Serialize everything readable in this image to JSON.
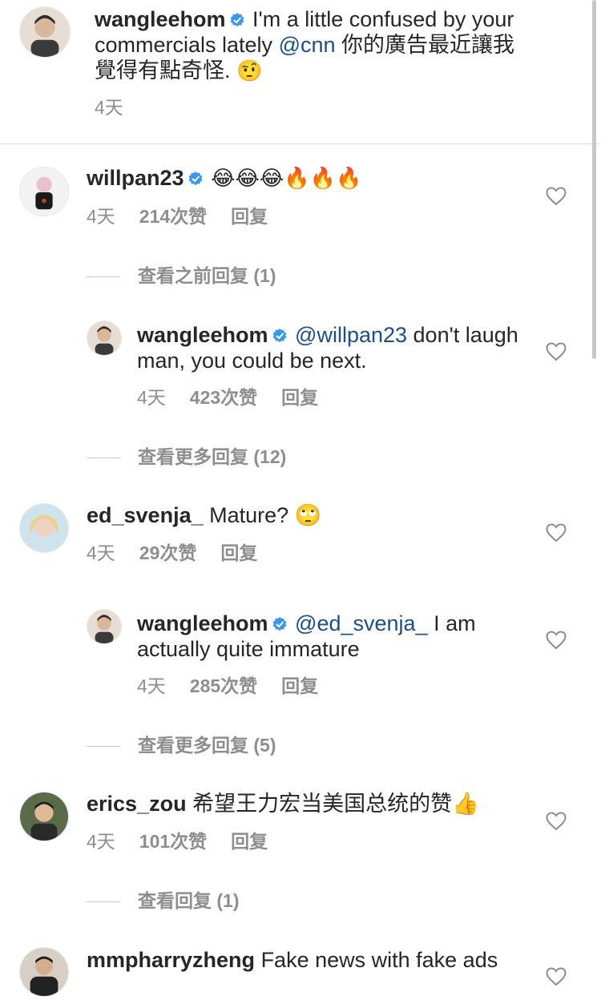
{
  "caption": {
    "username": "wangleehom",
    "text_before": "I'm a little confused by your commercials lately ",
    "mention": "@cnn",
    "text_after": " 你的廣告最近讓我覺得有點奇怪.",
    "emoji": "🤨",
    "time": "4天"
  },
  "comments": [
    {
      "username": "willpan23",
      "text": "😂😂😂🔥🔥🔥",
      "time": "4天",
      "likes": "214次赞",
      "reply": "回复",
      "view_more": "查看之前回复 (1)",
      "replies": [
        {
          "username": "wangleehom",
          "mention": "@willpan23",
          "text": " don't laugh man, you could be next.",
          "time": "4天",
          "likes": "423次赞",
          "reply": "回复"
        }
      ],
      "view_more_after": "查看更多回复 (12)"
    },
    {
      "username": "ed_svenja_",
      "text": "Mature? 🙄",
      "time": "4天",
      "likes": "29次赞",
      "reply": "回复",
      "replies": [
        {
          "username": "wangleehom",
          "mention": "@ed_svenja_",
          "text": " I am actually quite immature",
          "time": "4天",
          "likes": "285次赞",
          "reply": "回复"
        }
      ],
      "view_more_after": "查看更多回复 (5)"
    },
    {
      "username": "erics_zou",
      "text": "希望王力宏当美国总统的赞👍",
      "time": "4天",
      "likes": "101次赞",
      "reply": "回复",
      "view_more_after": "查看回复 (1)"
    },
    {
      "username": "mmpharryzheng",
      "text": "Fake news with fake ads"
    }
  ],
  "colors": {
    "verified": "#3897f0",
    "mention": "#1a4d8c",
    "meta": "#8e8e8e",
    "text": "#262626"
  },
  "icons": {
    "verified": "verified-badge-icon",
    "like": "heart-outline-icon"
  }
}
